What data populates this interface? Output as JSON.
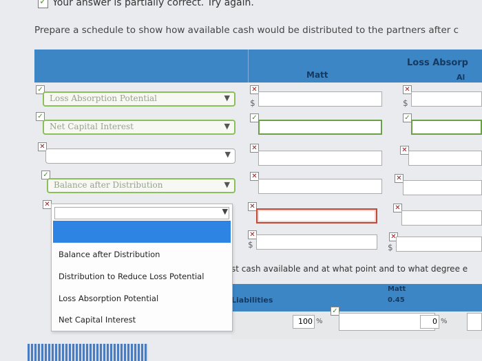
{
  "feedback": {
    "text": "Your answer is partially correct.  Try again."
  },
  "instruction": "Prepare a schedule to show how available cash would be distributed to the partners after c",
  "columns": {
    "matt": "Matt",
    "loss_absorp": "Loss Absorp",
    "al": "Al"
  },
  "rows": [
    {
      "select_label": "Loss Absorption Potential",
      "mark": "ok",
      "matt_mark": "x",
      "al_mark": "x",
      "prefix": "$"
    },
    {
      "select_label": "Net Capital Interest",
      "mark": "ok",
      "matt_mark": "ok",
      "al_mark": "ok",
      "prefix": ""
    },
    {
      "select_label": "",
      "mark": "x",
      "matt_mark": "x",
      "al_mark": "x",
      "prefix": ""
    },
    {
      "select_label": "Balance after Distribution",
      "mark": "ok",
      "matt_mark": "x",
      "al_mark": "x",
      "prefix": ""
    },
    {
      "select_label": "",
      "mark": "x",
      "matt_mark": "x",
      "al_mark": "x",
      "prefix": ""
    },
    {
      "select_label": "",
      "mark": "",
      "matt_mark": "x",
      "al_mark": "x",
      "prefix": "$"
    }
  ],
  "dropdown": {
    "options": [
      "Balance after Distribution",
      "Distribution to Reduce Loss Potential",
      "Loss Absorption Potential",
      "Net Capital Interest"
    ]
  },
  "bottom": {
    "text": "st cash available and at what point and to what degree e",
    "liabilities": "Liabilities",
    "matt": "Matt",
    "matt_pct": "0.45",
    "liab_pct": "100",
    "pct_symbol": "%",
    "zero": "0"
  },
  "colors": {
    "header_blue": "#3d86c6",
    "ok_green": "#8bbf5a",
    "error_red": "#c24a3a",
    "highlight": "#2e84e2"
  }
}
